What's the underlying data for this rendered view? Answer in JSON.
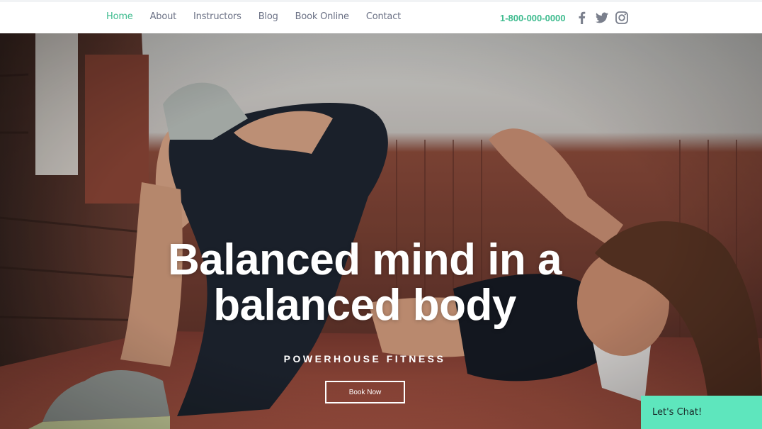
{
  "nav": {
    "items": [
      {
        "label": "Home",
        "active": true
      },
      {
        "label": "About",
        "active": false
      },
      {
        "label": "Instructors",
        "active": false
      },
      {
        "label": "Blog",
        "active": false
      },
      {
        "label": "Book Online",
        "active": false
      },
      {
        "label": "Contact",
        "active": false
      }
    ]
  },
  "header": {
    "phone": "1-800-000-0000",
    "social": [
      "facebook-icon",
      "twitter-icon",
      "instagram-icon"
    ]
  },
  "hero": {
    "headline_line1": "Balanced mind in a",
    "headline_line2": "balanced body",
    "subtitle": "POWERHOUSE FITNESS",
    "cta_label": "Book Now"
  },
  "chat": {
    "label": "Let's Chat!"
  },
  "colors": {
    "accent": "#3dbb8e",
    "nav_text": "#6b7185",
    "chat_bg": "#5ee6bd"
  }
}
